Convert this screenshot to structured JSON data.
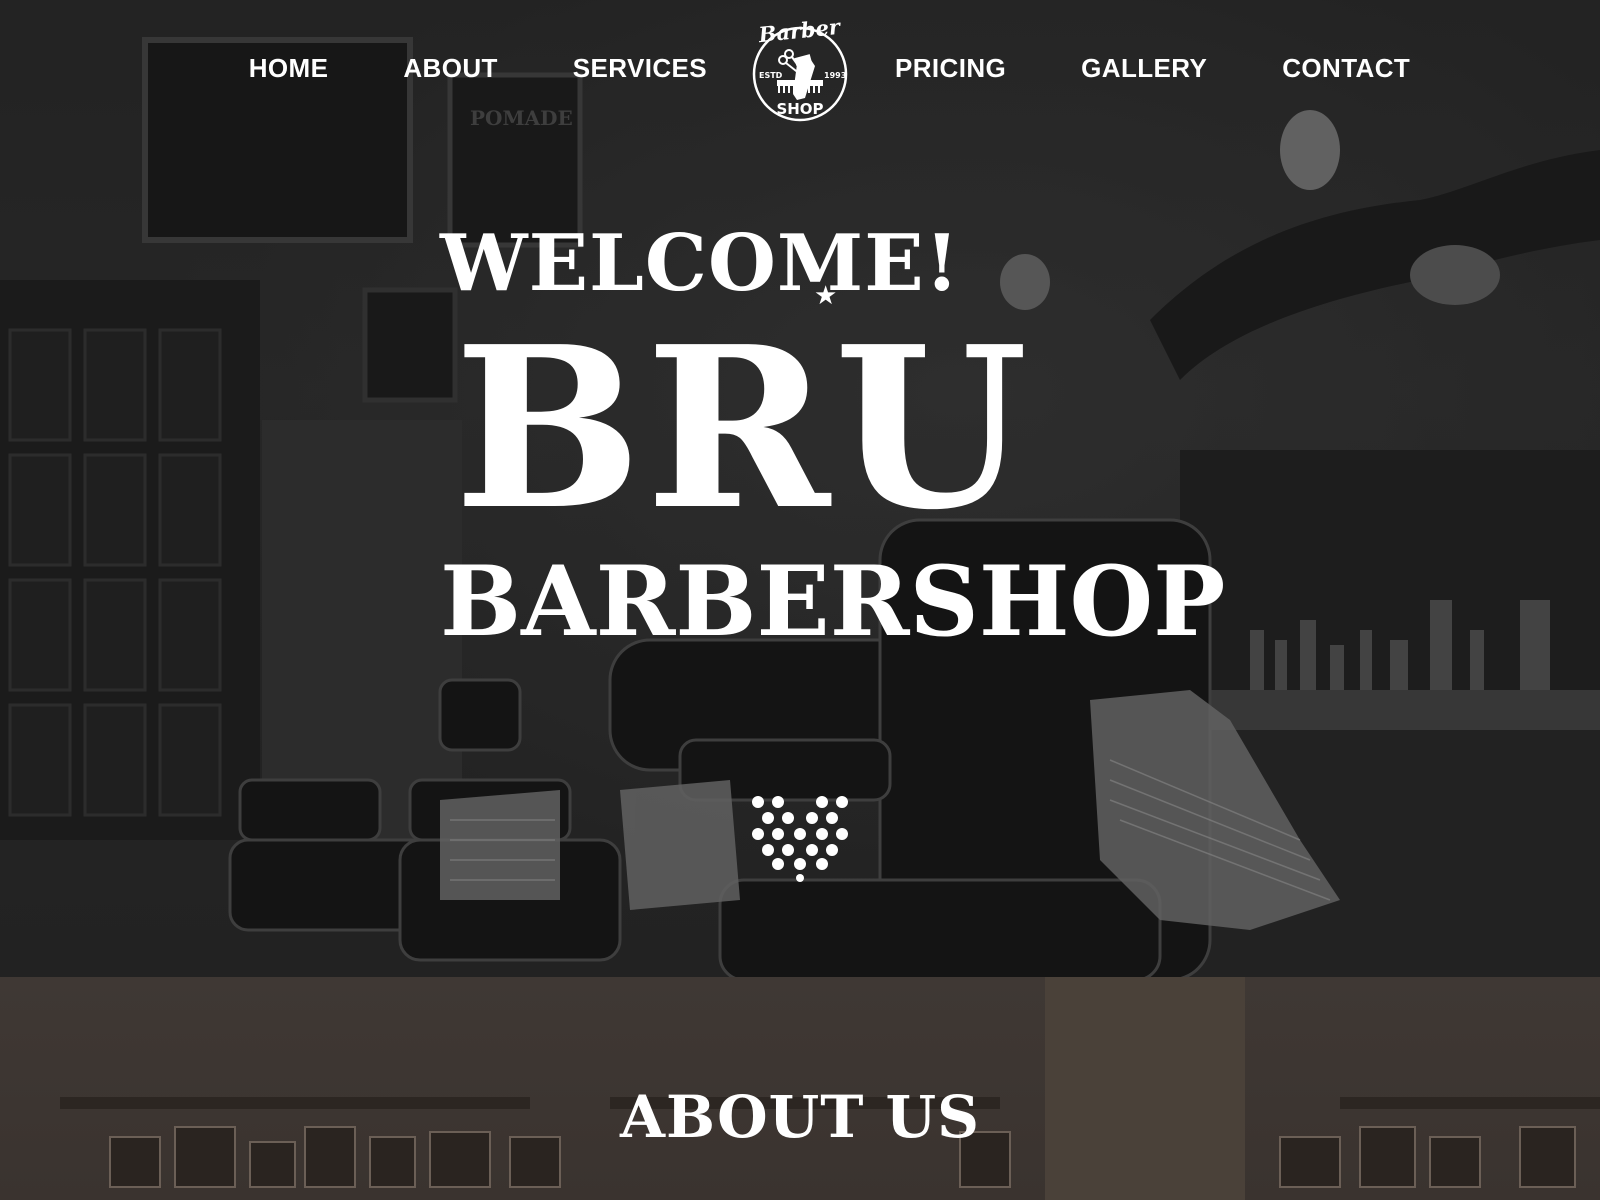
{
  "nav": {
    "left_items": [
      {
        "label": "HOME"
      },
      {
        "label": "ABOUT"
      },
      {
        "label": "SERVICES"
      }
    ],
    "right_items": [
      {
        "label": "PRICING"
      },
      {
        "label": "GALLERY"
      },
      {
        "label": "CONTACT"
      }
    ]
  },
  "logo": {
    "script_text": "Barber",
    "bottom_text": "SHOP",
    "estd_label": "ESTD",
    "year": "1993"
  },
  "hero": {
    "welcome": "WELCOME!",
    "title": "BRU",
    "subtitle": "BARBERSHOP",
    "scroll_icon": "dotted-chevron-down-icon"
  },
  "about": {
    "title": "ABOUT US"
  },
  "colors": {
    "hero_bg": "#2b2b2b",
    "about_bg": "#3f3834",
    "text": "#ffffff"
  }
}
